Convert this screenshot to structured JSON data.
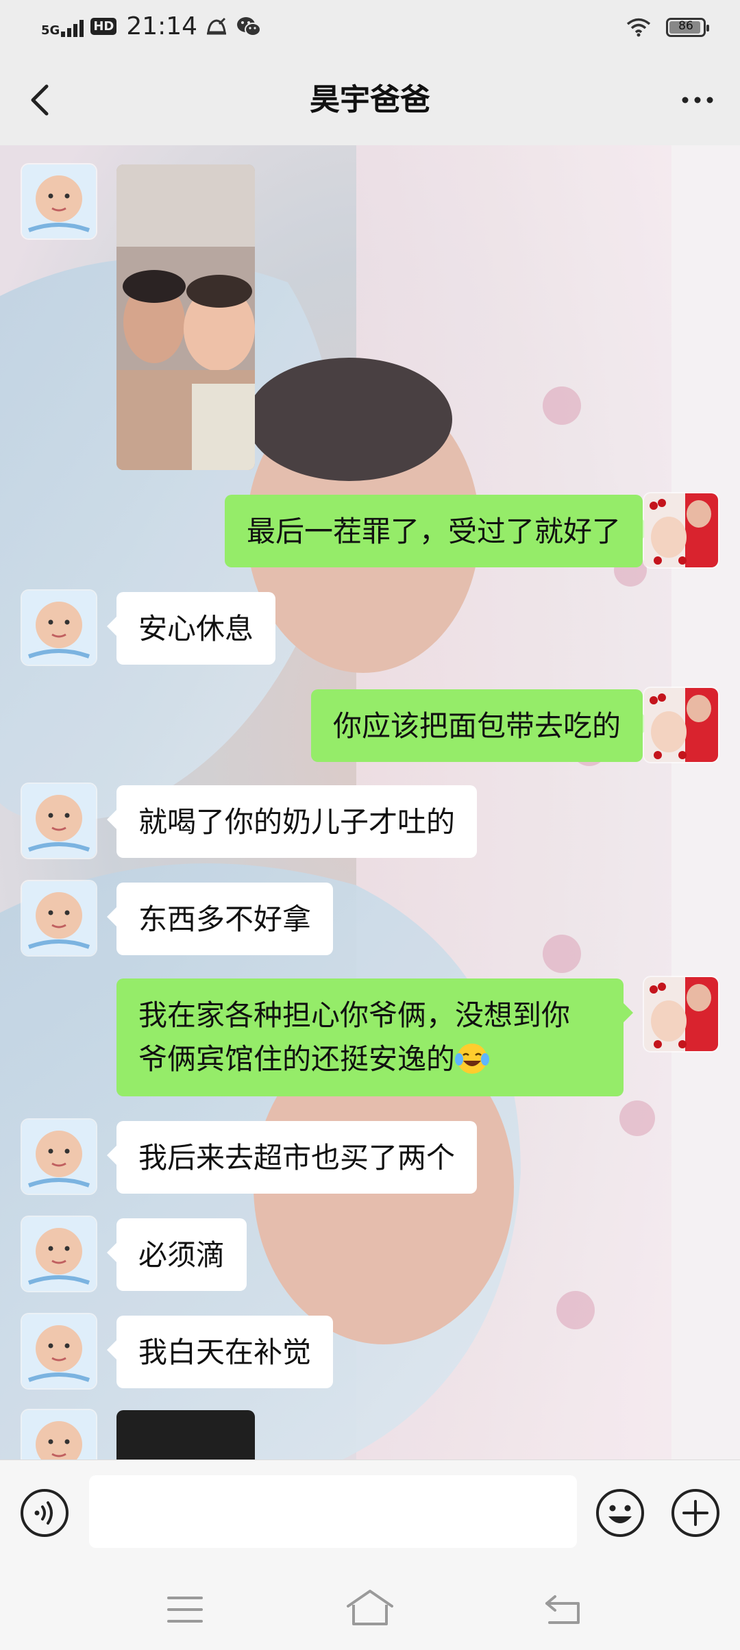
{
  "status_bar": {
    "network": "5G",
    "hd": "HD",
    "time": "21:14",
    "battery": "86",
    "battery_level": 0.86,
    "icons": [
      "signal-icon",
      "alarm-icon",
      "wechat-icon",
      "wifi-icon",
      "battery-icon"
    ]
  },
  "header": {
    "title": "昊宇爸爸",
    "back_icon": "chevron-left-icon",
    "more_icon": "more-dots-icon"
  },
  "messages": [
    {
      "sender": "other",
      "type": "image"
    },
    {
      "sender": "me",
      "type": "text",
      "text": "最后一茬罪了，受过了就好了"
    },
    {
      "sender": "other",
      "type": "text",
      "text": "安心休息"
    },
    {
      "sender": "me",
      "type": "text",
      "text": "你应该把面包带去吃的"
    },
    {
      "sender": "other",
      "type": "text",
      "text": "就喝了你的奶儿子才吐的"
    },
    {
      "sender": "other",
      "type": "text",
      "text": "东西多不好拿"
    },
    {
      "sender": "me",
      "type": "text",
      "lines": [
        "我在家各种担心你爷俩，没想到你",
        "爷俩宾馆住的还挺安逸的"
      ],
      "emoji": "laughing-crying-emoji"
    },
    {
      "sender": "other",
      "type": "text",
      "text": "我后来去超市也买了两个"
    },
    {
      "sender": "other",
      "type": "text",
      "text": "必须滴"
    },
    {
      "sender": "other",
      "type": "text",
      "text": "我白天在补觉"
    },
    {
      "sender": "other",
      "type": "image"
    }
  ],
  "input_bar": {
    "value": "",
    "icons": [
      "voice-icon",
      "emoji-icon",
      "plus-icon"
    ]
  },
  "nav_bar": {
    "icons": [
      "menu-icon",
      "home-icon",
      "back-icon"
    ]
  },
  "colors": {
    "outgoing_bubble": "#95ec69",
    "incoming_bubble": "#ffffff",
    "header_bg": "#ededed"
  }
}
